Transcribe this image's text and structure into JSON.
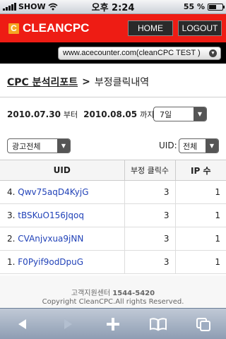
{
  "status_bar": {
    "carrier": "SHOW",
    "time": "오후 2:24",
    "battery": "55 %",
    "battery_level": 0.55
  },
  "header": {
    "logo_text": "CLEANCPC",
    "logo_mark": "C",
    "home_label": "HOME",
    "logout_label": "LOGOUT",
    "brand_color": "#ee1c14"
  },
  "site_selector": {
    "value": "www.acecounter.com(cleanCPC TEST )"
  },
  "breadcrumb": {
    "parent": "CPC 분석리포트",
    "separator": ">",
    "current": "부정클릭내역"
  },
  "date_range": {
    "start": "2010.07.30",
    "start_suffix": "부터",
    "end": "2010.08.05",
    "end_suffix": "까지",
    "period_value": "7일"
  },
  "filters": {
    "ad_value": "광고전체",
    "uid_label": "UID:",
    "uid_value": "전체"
  },
  "table": {
    "headers": [
      "UID",
      "부정 클릭수",
      "IP 수"
    ],
    "rows": [
      {
        "index": "4.",
        "uid": "Qwv75aqD4KyjG",
        "clicks": "3",
        "ips": "1"
      },
      {
        "index": "3.",
        "uid": "tBSKuO156Jqoq",
        "clicks": "3",
        "ips": "1"
      },
      {
        "index": "2.",
        "uid": "CVAnjvxua9jNN",
        "clicks": "3",
        "ips": "1"
      },
      {
        "index": "1.",
        "uid": "F0Pyif9odDpuG",
        "clicks": "3",
        "ips": "1"
      }
    ]
  },
  "footer": {
    "support_label": "고객지원센터",
    "phone": "1544-5420",
    "copyright": "Copyright CleanCPC.All rights Reserved."
  },
  "toolbar": {
    "back_icon": "back-arrow",
    "forward_icon": "forward-arrow",
    "add_icon": "plus",
    "bookmarks_icon": "open-book",
    "pages_icon": "pages"
  }
}
